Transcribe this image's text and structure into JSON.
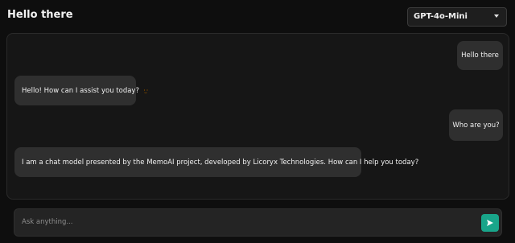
{
  "header": {
    "title": "Hello there",
    "model_select": {
      "value": "GPT-4o-Mini"
    }
  },
  "chat": {
    "messages": [
      {
        "role": "user",
        "text": "Hello there"
      },
      {
        "role": "assistant",
        "text": "Hello! How can I assist you today?",
        "emoji": "smiling-face"
      },
      {
        "role": "user",
        "text": "Who are you?"
      },
      {
        "role": "assistant",
        "text": "I am a chat model presented by the MemoAI project, developed by Licoryx Technologies. How can I help you today?"
      }
    ]
  },
  "composer": {
    "placeholder": "Ask anything...",
    "value": "",
    "send_icon": "send-icon"
  },
  "colors": {
    "background": "#0e0e0e",
    "panel": "#161616",
    "bubble": "#2f2f2f",
    "accent": "#19a58a"
  }
}
